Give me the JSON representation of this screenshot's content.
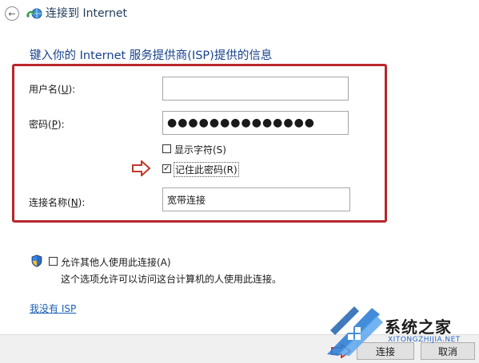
{
  "header": {
    "title": "连接到 Internet"
  },
  "section": {
    "title": "键入你的 Internet 服务提供商(ISP)提供的信息"
  },
  "form": {
    "username": {
      "label_prefix": "用户名(",
      "label_accel": "U",
      "label_suffix": "):",
      "value": ""
    },
    "password": {
      "label_prefix": "密码(",
      "label_accel": "P",
      "label_suffix": "):",
      "value": "●●●●●●●●●●●●●●"
    },
    "show_chars": {
      "label": "显示字符(S)",
      "checked": false
    },
    "remember_password": {
      "label": "记住此密码(R)",
      "checked": true
    },
    "connection_name": {
      "label_prefix": "连接名称(",
      "label_accel": "N",
      "label_suffix": "):",
      "value": "宽带连接"
    }
  },
  "allow_others": {
    "label": "允许其他人使用此连接(A)",
    "description": "这个选项允许可以访问这台计算机的人使用此连接。",
    "checked": false
  },
  "no_isp_link": "我没有 ISP",
  "footer": {
    "connect_label": "连接",
    "cancel_label": "取消"
  },
  "watermark": {
    "name": "系统之家",
    "url": "XITONGZHIJIA.NET"
  },
  "colors": {
    "highlight_border": "#b8262a",
    "section_title": "#17428c",
    "link": "#1a5fb4",
    "arrow": "#c0392b"
  },
  "icons": {
    "back": "back-arrow-icon",
    "network": "network-globe-icon",
    "pointer": "right-pointer-arrow-icon",
    "shield": "uac-shield-icon"
  }
}
